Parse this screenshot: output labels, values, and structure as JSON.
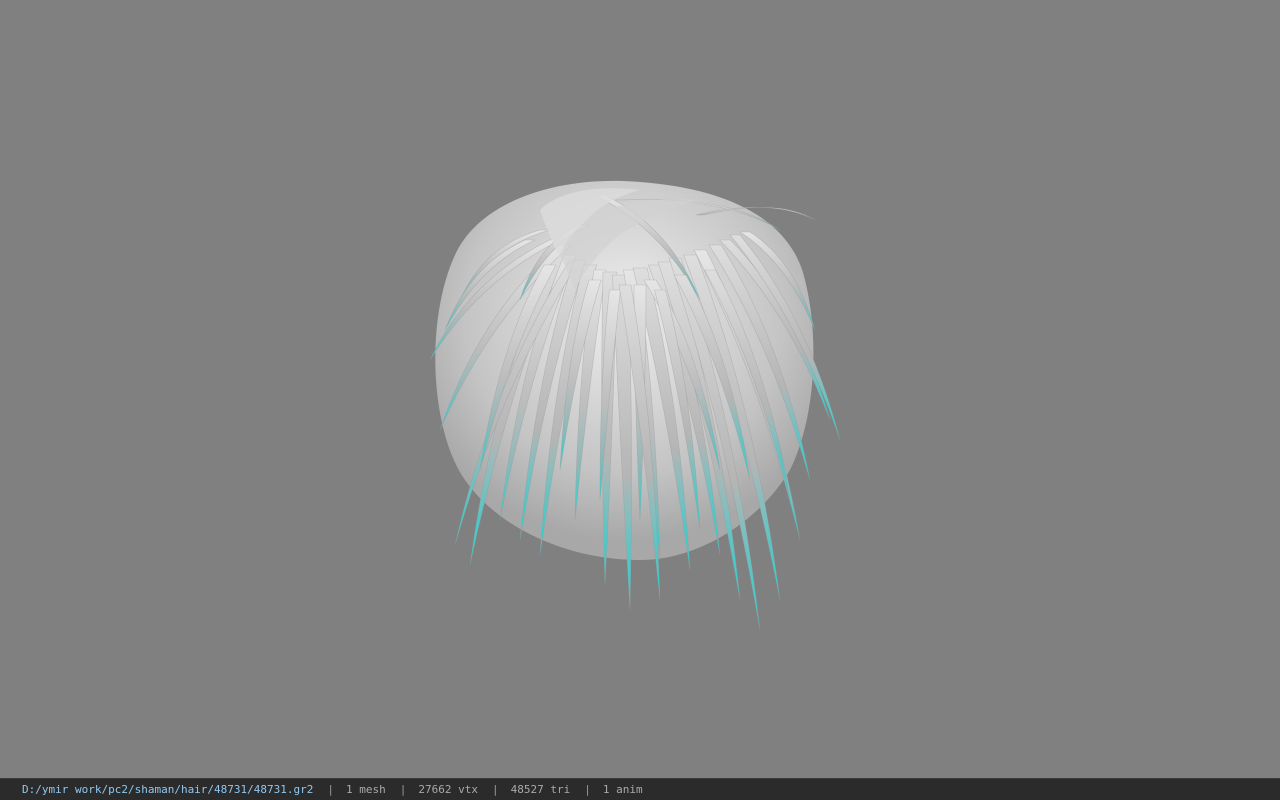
{
  "viewer": {
    "background_color": "#808080",
    "model": {
      "name": "hair-mesh",
      "hair_color": "#cfcfcf",
      "tip_color": "#1fd6d6"
    }
  },
  "status_bar": {
    "file_path": "D:/ymir work/pc2/shaman/hair/48731/48731.gr2",
    "separator": "|",
    "mesh_count": "1 mesh",
    "vertex_count": "27662 vtx",
    "triangle_count": "48527 tri",
    "anim_count": "1 anim"
  }
}
